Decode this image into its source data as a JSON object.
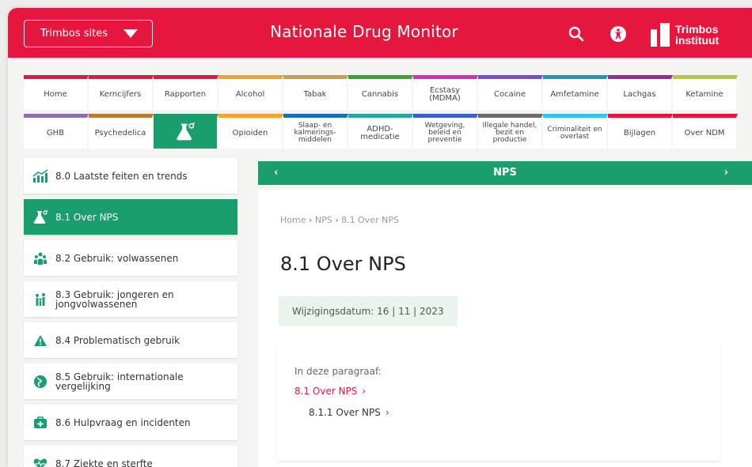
{
  "header": {
    "sites_label": "Trimbos sites",
    "title": "Nationale Drug Monitor",
    "logo_line1": "Trimbos",
    "logo_line2": "instituut",
    "bg_color": "#e5173f"
  },
  "nav": {
    "row1": [
      {
        "label": "Home",
        "color": "#e5173f"
      },
      {
        "label": "Kerncijfers",
        "color": "#e5173f"
      },
      {
        "label": "Rapporten",
        "color": "#e5173f"
      },
      {
        "label": "Alcohol",
        "color": "#f2a22e"
      },
      {
        "label": "Tabak",
        "color": "#c8a24a"
      },
      {
        "label": "Cannabis",
        "color": "#3aa535"
      },
      {
        "label": "Ecstasy (MDMA)",
        "color": "#d62fb6"
      },
      {
        "label": "Cocaine",
        "color": "#7b4bd6"
      },
      {
        "label": "Amfetamine",
        "color": "#1f9bb0"
      },
      {
        "label": "Lachgas",
        "color": "#9c2b91"
      },
      {
        "label": "Ketamine",
        "color": "#b9c83a"
      }
    ],
    "row2": [
      {
        "label": "GHB",
        "color": "#8c6db0"
      },
      {
        "label": "Psychedelica",
        "color": "#b97a3b"
      },
      {
        "label": "",
        "color": "#1a9e6e",
        "active": true,
        "icon": "flask-icon"
      },
      {
        "label": "Opioiden",
        "color": "#f2a22e"
      },
      {
        "label": "Slaap- en kalmerings-middelen",
        "color": "#1f6fb0"
      },
      {
        "label": "ADHD-medicatie",
        "color": "#2aa3a3"
      },
      {
        "label": "Wetgeving, beleid en preventie",
        "color": "#3b5fc8"
      },
      {
        "label": "Illegale handel, bezit en productie",
        "color": "#6a6a6a"
      },
      {
        "label": "Criminaliteit en overlast",
        "color": "#36c5e8"
      },
      {
        "label": "Bijlagen",
        "color": "#e5173f"
      },
      {
        "label": "Over NDM",
        "color": "#e5173f"
      }
    ]
  },
  "sidebar": {
    "items": [
      {
        "label": "8.0 Laatste feiten en trends",
        "icon": "chart-icon"
      },
      {
        "label": "8.1 Over NPS",
        "icon": "flask-icon",
        "active": true
      },
      {
        "label": "8.2 Gebruik: volwassenen",
        "icon": "people-group-icon"
      },
      {
        "label": "8.3 Gebruik: jongeren en jongvolwassenen",
        "icon": "people-young-icon"
      },
      {
        "label": "8.4 Problematisch gebruik",
        "icon": "warning-icon"
      },
      {
        "label": "8.5 Gebruik: internationale vergelijking",
        "icon": "globe-icon"
      },
      {
        "label": "8.6 Hulpvraag en incidenten",
        "icon": "medical-kit-icon"
      },
      {
        "label": "8.7 Ziekte en sterfte",
        "icon": "heart-icon"
      }
    ],
    "accent": "#1a9e6e"
  },
  "section_bar": {
    "title": "NPS",
    "prev": "‹",
    "next": "›"
  },
  "main": {
    "breadcrumb": {
      "home": "Home",
      "sep": "›",
      "section": "NPS",
      "current": "8.1 Over NPS"
    },
    "title": "8.1 Over NPS",
    "date_label": "Wijzigingsdatum: 16 | 11 | 2023",
    "toc": {
      "heading": "In deze paragraaf:",
      "link1": "8.1 Over NPS",
      "link2": "8.1.1 Over NPS",
      "chevron": "›"
    }
  }
}
